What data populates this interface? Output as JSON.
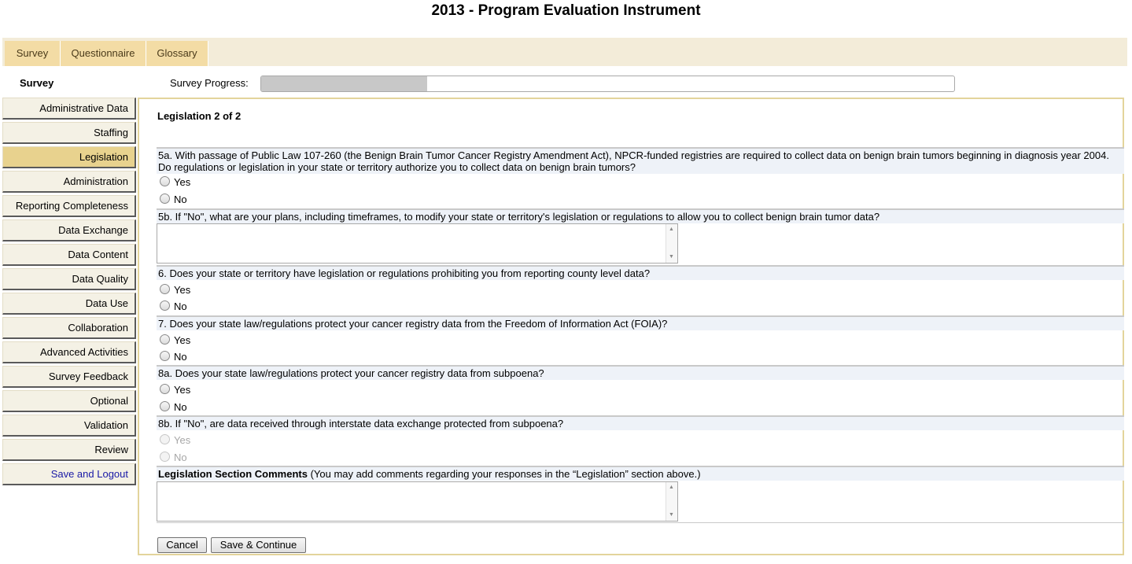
{
  "page_title": "2013 - Program Evaluation Instrument",
  "tabs": [
    "Survey",
    "Questionnaire",
    "Glossary"
  ],
  "sidebar_heading": "Survey",
  "progress": {
    "label": "Survey Progress:",
    "fraction": 0.24
  },
  "sidebar": {
    "items": [
      "Administrative Data",
      "Staffing",
      "Legislation",
      "Administration",
      "Reporting Completeness",
      "Data Exchange",
      "Data Content",
      "Data Quality",
      "Data Use",
      "Collaboration",
      "Advanced Activities",
      "Survey Feedback",
      "Optional",
      "Validation",
      "Review",
      "Save and Logout"
    ],
    "active": "Legislation"
  },
  "section_title": "Legislation 2 of 2",
  "questions": {
    "q5a": "5a. With passage of Public Law 107-260 (the Benign Brain Tumor Cancer Registry Amendment Act), NPCR-funded registries are required to collect data on benign brain tumors beginning in diagnosis year 2004. Do regulations or legislation in your state or territory authorize you to collect data on benign brain tumors?",
    "q5b": "5b. If \"No\", what are your plans, including timeframes, to modify your state or territory's legislation or regulations to allow you to collect benign brain tumor data?",
    "q6": "6. Does your state or territory have legislation or regulations prohibiting you from reporting county level data?",
    "q7": "7. Does your state law/regulations protect your cancer registry data from the Freedom of Information Act (FOIA)?",
    "q8a": "8a. Does your state law/regulations protect your cancer registry data from subpoena?",
    "q8b": "8b. If \"No\", are data received through interstate data exchange protected from subpoena?"
  },
  "options": {
    "yes": "Yes",
    "no": "No"
  },
  "comments": {
    "label_bold": "Legislation Section Comments",
    "label_rest": " (You may add comments regarding your responses in the “Legislation” section above.)"
  },
  "buttons": {
    "cancel": "Cancel",
    "save": "Save & Continue"
  }
}
